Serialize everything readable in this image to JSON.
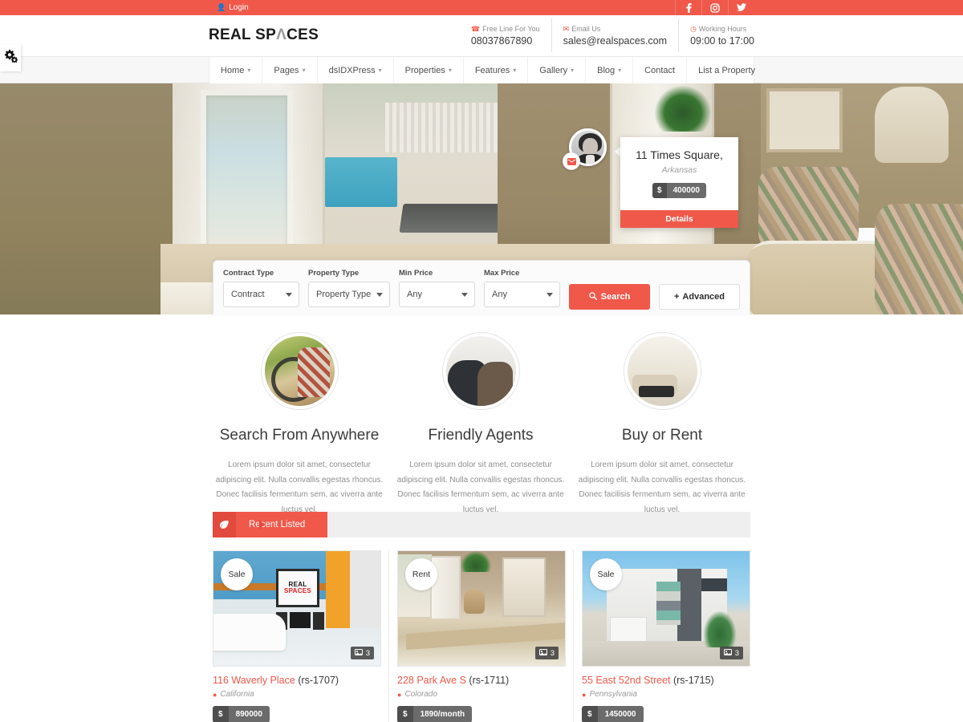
{
  "topbar": {
    "login_label": "Login",
    "login_icon": "user-icon",
    "socials": [
      {
        "name": "facebook",
        "glyph": "f"
      },
      {
        "name": "instagram",
        "glyph": "◎"
      },
      {
        "name": "twitter",
        "glyph": "t"
      }
    ]
  },
  "header": {
    "logo_part1": "REAL SP",
    "logo_chevron": "Λ",
    "logo_part2": "CES",
    "contacts": [
      {
        "label": "Free Line For You",
        "value": "08037867890",
        "icon": "phone-icon"
      },
      {
        "label": "Email Us",
        "value": "sales@realspaces.com",
        "icon": "envelope-icon"
      },
      {
        "label": "Working Hours",
        "value": "09:00 to 17:00",
        "icon": "clock-icon"
      }
    ]
  },
  "nav": {
    "items": [
      {
        "label": "Home",
        "caret": true
      },
      {
        "label": "Pages",
        "caret": true
      },
      {
        "label": "dsIDXPress",
        "caret": true
      },
      {
        "label": "Properties",
        "caret": true
      },
      {
        "label": "Features",
        "caret": true
      },
      {
        "label": "Gallery",
        "caret": true
      },
      {
        "label": "Blog",
        "caret": true
      },
      {
        "label": "Contact",
        "caret": false
      },
      {
        "label": "List a Property",
        "caret": false
      }
    ]
  },
  "settings_tab": {
    "icon": "gears-icon"
  },
  "hero": {
    "property_card": {
      "title": "11 Times Square,",
      "subtitle": "Arkansas",
      "currency": "$",
      "price": "400000",
      "details_label": "Details"
    },
    "agent_avatar_name": "agent-avatar",
    "mail_badge_name": "envelope-badge"
  },
  "search": {
    "fields": [
      {
        "label": "Contract Type",
        "value": "Contract",
        "name": "contract-type-select"
      },
      {
        "label": "Property Type",
        "value": "Property Type",
        "name": "property-type-select"
      },
      {
        "label": "Min Price",
        "value": "Any",
        "name": "min-price-select"
      },
      {
        "label": "Max Price",
        "value": "Any",
        "name": "max-price-select"
      }
    ],
    "search_button": "Search",
    "advanced_button": "Advanced",
    "advanced_prefix": "+"
  },
  "features": {
    "body_text": "Lorem ipsum dolor sit amet, consectetur adipiscing elit. Nulla convallis egestas rhoncus. Donec facilisis fermentum sem, ac viverra ante luctus vel.",
    "items": [
      {
        "title": "Search From Anywhere",
        "image_name": "woman-with-bicycle-laptop-photo"
      },
      {
        "title": "Friendly Agents",
        "image_name": "two-agents-meeting-photo"
      },
      {
        "title": "Buy or Rent",
        "image_name": "living-room-interior-photo"
      }
    ]
  },
  "recent": {
    "heading": "Recent Listed",
    "heading_icon": "leaf-icon"
  },
  "listings": [
    {
      "badge": "Sale",
      "photo_count": "3",
      "title_link": "116 Waverly Place",
      "title_code": "(rs-1707)",
      "location": "California",
      "currency": "$",
      "price": "890000",
      "image_name": "blue-living-room-photo",
      "art_line1": "REAL",
      "art_line2": "SPACES"
    },
    {
      "badge": "Rent",
      "photo_count": "3",
      "title_link": "228 Park Ave S",
      "title_code": "(rs-1711)",
      "location": "Colorado",
      "currency": "$",
      "price": "1890/month",
      "image_name": "bedroom-patio-photo"
    },
    {
      "badge": "Sale",
      "photo_count": "3",
      "title_link": "55 East 52nd Street",
      "title_code": "(rs-1715)",
      "location": "Pennsylvania",
      "currency": "$",
      "price": "1450000",
      "image_name": "modern-house-exterior-photo"
    }
  ],
  "colors": {
    "accent": "#f0584a",
    "accent_dark": "#e24a3d",
    "chip_dark": "#4e4e4e",
    "chip_light": "#6b6b6b",
    "text": "#3a3a3a",
    "muted": "#9a9a9a"
  }
}
